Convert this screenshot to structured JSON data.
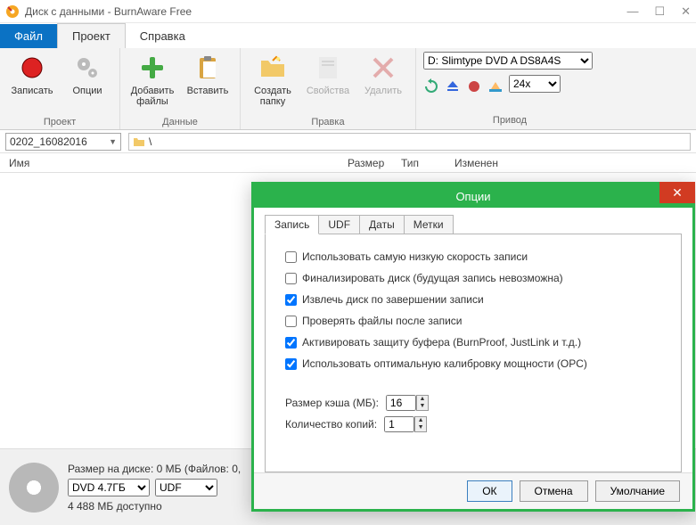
{
  "window": {
    "title": "Диск с данными - BurnAware Free"
  },
  "menu": {
    "file": "Файл",
    "project": "Проект",
    "help": "Справка"
  },
  "ribbon": {
    "record": "Записать",
    "options": "Опции",
    "g_project": "Проект",
    "add_files": "Добавить\nфайлы",
    "paste": "Вставить",
    "g_data": "Данные",
    "make_folder": "Создать\nпапку",
    "properties": "Свойства",
    "delete": "Удалить",
    "g_edit": "Правка",
    "drive_sel": "D: Slimtype DVD A DS8A4S",
    "speed_sel": "24x",
    "g_drive": "Привод"
  },
  "path": {
    "combo_value": "0202_16082016",
    "path_text": "\\"
  },
  "list": {
    "col_name": "Имя",
    "col_size": "Размер",
    "col_type": "Тип",
    "col_modified": "Изменен"
  },
  "bottom": {
    "size_line": "Размер на диске: 0 МБ (Файлов: 0,",
    "disc_type": "DVD 4.7ГБ",
    "fs": "UDF",
    "avail": "4 488 МБ доступно"
  },
  "dialog": {
    "title": "Опции",
    "tabs": {
      "rec": "Запись",
      "udf": "UDF",
      "dates": "Даты",
      "labels": "Метки"
    },
    "opt1": "Использовать самую низкую скорость записи",
    "opt2": "Финализировать диск (будущая запись невозможна)",
    "opt3": "Извлечь диск по завершении записи",
    "opt4": "Проверять файлы после записи",
    "opt5": "Активировать защиту буфера (BurnProof, JustLink и т.д.)",
    "opt6": "Использовать оптимальную калибровку мощности (OPC)",
    "cache_lbl": "Размер кэша (МБ):",
    "cache_val": "16",
    "copies_lbl": "Количество копий:",
    "copies_val": "1",
    "ok": "ОК",
    "cancel": "Отмена",
    "default": "Умолчание"
  }
}
